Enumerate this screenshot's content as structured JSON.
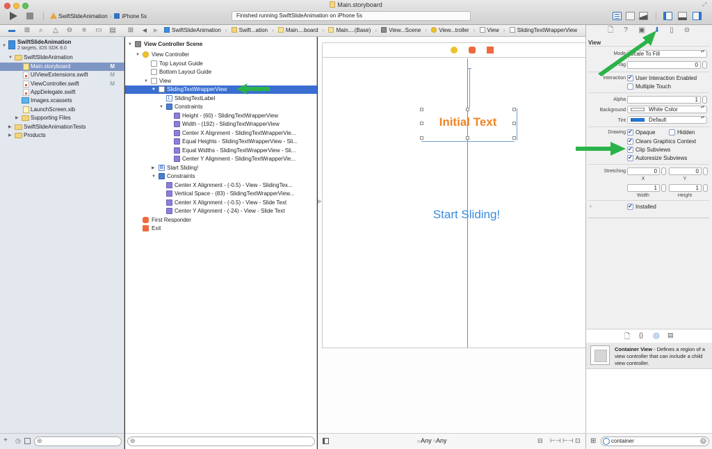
{
  "window": {
    "title": "Main.storyboard",
    "scheme": "SwiftSlideAnimation",
    "device": "iPhone 5s",
    "status": "Finished running SwiftSlideAnimation on iPhone 5s"
  },
  "toolbar": {
    "run_icon": "play-icon",
    "stop_icon": "stop-icon",
    "editor_buttons": [
      "standard-editor-icon",
      "assistant-editor-icon",
      "version-editor-icon"
    ],
    "view_buttons": [
      "navigator-toggle-icon",
      "debug-area-toggle-icon",
      "utilities-toggle-icon"
    ]
  },
  "navigator_tabs": [
    "project-icon",
    "symbol-icon",
    "find-icon",
    "issue-icon",
    "test-icon",
    "debug-icon",
    "breakpoint-icon",
    "report-icon"
  ],
  "breadcrumb": [
    "SwiftSlideAnimation",
    "Swift...ation",
    "Main....board",
    "Main....(Base)",
    "View...Scene",
    "View...troller",
    "View",
    "SlidingTextWrapperView"
  ],
  "navigator": {
    "project_name": "SwiftSlideAnimation",
    "project_sub": "2 targets, iOS SDK 8.0",
    "items": [
      {
        "label": "SwiftSlideAnimation",
        "type": "folder",
        "badge": ""
      },
      {
        "label": "Main.storyboard",
        "type": "storyboard",
        "badge": "M",
        "selected": true
      },
      {
        "label": "UIViewExtensions.swift",
        "type": "swift",
        "badge": "M"
      },
      {
        "label": "ViewController.swift",
        "type": "swift",
        "badge": "M"
      },
      {
        "label": "AppDelegate.swift",
        "type": "swift",
        "badge": ""
      },
      {
        "label": "Images.xcassets",
        "type": "assets",
        "badge": ""
      },
      {
        "label": "LaunchScreen.xib",
        "type": "xib",
        "badge": ""
      },
      {
        "label": "Supporting Files",
        "type": "folder",
        "badge": ""
      },
      {
        "label": "SwiftSlideAnimationTests",
        "type": "folder",
        "badge": ""
      },
      {
        "label": "Products",
        "type": "folder",
        "badge": ""
      }
    ]
  },
  "outline": {
    "items": [
      {
        "label": "View Controller Scene",
        "bold": true
      },
      {
        "label": "View Controller"
      },
      {
        "label": "Top Layout Guide"
      },
      {
        "label": "Bottom Layout Guide"
      },
      {
        "label": "View"
      },
      {
        "label": "SlidingTextWrapperView",
        "selected": true
      },
      {
        "label": "SlidingTextLabel"
      },
      {
        "label": "Constraints"
      },
      {
        "label": "Height - (60) - SlidingTextWrapperView"
      },
      {
        "label": "Width - (192) - SlidingTextWrapperView"
      },
      {
        "label": "Center X Alignment - SlidingTextWrapperVie..."
      },
      {
        "label": "Equal Heights - SlidingTextWrapperView - Sli..."
      },
      {
        "label": "Equal Widths - SlidingTextWrapperView - Sli..."
      },
      {
        "label": "Center Y Alignment - SlidingTextWrapperVie..."
      },
      {
        "label": "Start Sliding!"
      },
      {
        "label": "Constraints"
      },
      {
        "label": "Center X Alignment - (-0.5) - View - SlidingTex..."
      },
      {
        "label": "Vertical Space - (83) - SlidingTextWrapperView..."
      },
      {
        "label": "Center X Alignment - (-0.5) - View - Slide Text"
      },
      {
        "label": "Center Y Alignment - (-24) - View - Slide Text"
      },
      {
        "label": "First Responder"
      },
      {
        "label": "Exit"
      }
    ]
  },
  "canvas": {
    "initial_text": "Initial Text",
    "button_text": "Start Sliding!",
    "colors": {
      "label": "#f08424",
      "button": "#3b8ae0",
      "guide": "#5b8fc6"
    },
    "size_class": {
      "w_prefix": "w",
      "w_value": "Any",
      "h_prefix": "h",
      "h_value": "Any"
    }
  },
  "inspector": {
    "tabs": [
      "file-inspector-icon",
      "quick-help-icon",
      "identity-inspector-icon",
      "attributes-inspector-icon",
      "size-inspector-icon",
      "connections-inspector-icon"
    ],
    "active_tab": 3,
    "section_title": "View",
    "mode_label": "Mode",
    "mode_value": "Scale To Fill",
    "tag_label": "Tag",
    "tag_value": "0",
    "interaction_label": "Interaction",
    "user_interaction_enabled": {
      "label": "User Interaction Enabled",
      "checked": true
    },
    "multiple_touch": {
      "label": "Multiple Touch",
      "checked": false
    },
    "alpha_label": "Alpha",
    "alpha_value": "1",
    "background_label": "Background",
    "background_value": "White Color",
    "tint_label": "Tint",
    "tint_value": "Default",
    "drawing_label": "Drawing",
    "opaque": {
      "label": "Opaque",
      "checked": true
    },
    "hidden": {
      "label": "Hidden",
      "checked": false
    },
    "clears_graphics": {
      "label": "Clears Graphics Context",
      "checked": true
    },
    "clip_subviews": {
      "label": "Clip Subviews",
      "checked": true
    },
    "autoresize_subviews": {
      "label": "Autoresize Subviews",
      "checked": true
    },
    "stretching_label": "Stretching",
    "stretch_x": "0",
    "stretch_y": "0",
    "stretch_w": "1",
    "stretch_h": "1",
    "x_label": "X",
    "y_label": "Y",
    "width_label": "Width",
    "height_label": "Height",
    "installed": {
      "label": "Installed",
      "checked": true
    },
    "plus": "+"
  },
  "library": {
    "tabs": [
      "file-template-icon",
      "code-snippet-icon",
      "object-library-icon",
      "media-library-icon"
    ],
    "active_tab": 2,
    "item_title": "Container View",
    "item_desc": " - Defines a region of a view controller that can include a child view controller.",
    "search_value": "container"
  },
  "footer": {
    "nav_plus": "+"
  }
}
